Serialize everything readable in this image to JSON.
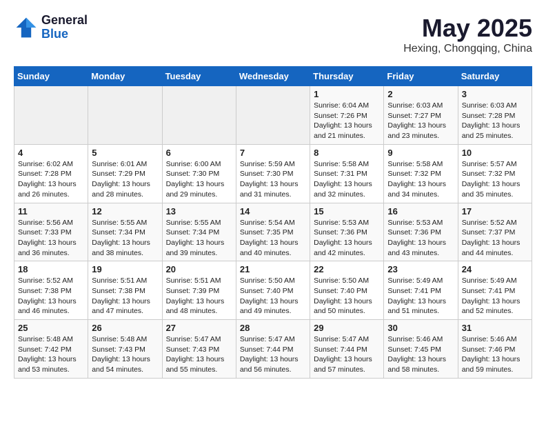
{
  "logo": {
    "general": "General",
    "blue": "Blue"
  },
  "title": "May 2025",
  "location": "Hexing, Chongqing, China",
  "days_of_week": [
    "Sunday",
    "Monday",
    "Tuesday",
    "Wednesday",
    "Thursday",
    "Friday",
    "Saturday"
  ],
  "weeks": [
    [
      {
        "day": "",
        "empty": true
      },
      {
        "day": "",
        "empty": true
      },
      {
        "day": "",
        "empty": true
      },
      {
        "day": "",
        "empty": true
      },
      {
        "day": "1",
        "sunrise": "6:04 AM",
        "sunset": "7:26 PM",
        "daylight": "13 hours and 21 minutes."
      },
      {
        "day": "2",
        "sunrise": "6:03 AM",
        "sunset": "7:27 PM",
        "daylight": "13 hours and 23 minutes."
      },
      {
        "day": "3",
        "sunrise": "6:03 AM",
        "sunset": "7:28 PM",
        "daylight": "13 hours and 25 minutes."
      }
    ],
    [
      {
        "day": "4",
        "sunrise": "6:02 AM",
        "sunset": "7:28 PM",
        "daylight": "13 hours and 26 minutes."
      },
      {
        "day": "5",
        "sunrise": "6:01 AM",
        "sunset": "7:29 PM",
        "daylight": "13 hours and 28 minutes."
      },
      {
        "day": "6",
        "sunrise": "6:00 AM",
        "sunset": "7:30 PM",
        "daylight": "13 hours and 29 minutes."
      },
      {
        "day": "7",
        "sunrise": "5:59 AM",
        "sunset": "7:30 PM",
        "daylight": "13 hours and 31 minutes."
      },
      {
        "day": "8",
        "sunrise": "5:58 AM",
        "sunset": "7:31 PM",
        "daylight": "13 hours and 32 minutes."
      },
      {
        "day": "9",
        "sunrise": "5:58 AM",
        "sunset": "7:32 PM",
        "daylight": "13 hours and 34 minutes."
      },
      {
        "day": "10",
        "sunrise": "5:57 AM",
        "sunset": "7:32 PM",
        "daylight": "13 hours and 35 minutes."
      }
    ],
    [
      {
        "day": "11",
        "sunrise": "5:56 AM",
        "sunset": "7:33 PM",
        "daylight": "13 hours and 36 minutes."
      },
      {
        "day": "12",
        "sunrise": "5:55 AM",
        "sunset": "7:34 PM",
        "daylight": "13 hours and 38 minutes."
      },
      {
        "day": "13",
        "sunrise": "5:55 AM",
        "sunset": "7:34 PM",
        "daylight": "13 hours and 39 minutes."
      },
      {
        "day": "14",
        "sunrise": "5:54 AM",
        "sunset": "7:35 PM",
        "daylight": "13 hours and 40 minutes."
      },
      {
        "day": "15",
        "sunrise": "5:53 AM",
        "sunset": "7:36 PM",
        "daylight": "13 hours and 42 minutes."
      },
      {
        "day": "16",
        "sunrise": "5:53 AM",
        "sunset": "7:36 PM",
        "daylight": "13 hours and 43 minutes."
      },
      {
        "day": "17",
        "sunrise": "5:52 AM",
        "sunset": "7:37 PM",
        "daylight": "13 hours and 44 minutes."
      }
    ],
    [
      {
        "day": "18",
        "sunrise": "5:52 AM",
        "sunset": "7:38 PM",
        "daylight": "13 hours and 46 minutes."
      },
      {
        "day": "19",
        "sunrise": "5:51 AM",
        "sunset": "7:38 PM",
        "daylight": "13 hours and 47 minutes."
      },
      {
        "day": "20",
        "sunrise": "5:51 AM",
        "sunset": "7:39 PM",
        "daylight": "13 hours and 48 minutes."
      },
      {
        "day": "21",
        "sunrise": "5:50 AM",
        "sunset": "7:40 PM",
        "daylight": "13 hours and 49 minutes."
      },
      {
        "day": "22",
        "sunrise": "5:50 AM",
        "sunset": "7:40 PM",
        "daylight": "13 hours and 50 minutes."
      },
      {
        "day": "23",
        "sunrise": "5:49 AM",
        "sunset": "7:41 PM",
        "daylight": "13 hours and 51 minutes."
      },
      {
        "day": "24",
        "sunrise": "5:49 AM",
        "sunset": "7:41 PM",
        "daylight": "13 hours and 52 minutes."
      }
    ],
    [
      {
        "day": "25",
        "sunrise": "5:48 AM",
        "sunset": "7:42 PM",
        "daylight": "13 hours and 53 minutes."
      },
      {
        "day": "26",
        "sunrise": "5:48 AM",
        "sunset": "7:43 PM",
        "daylight": "13 hours and 54 minutes."
      },
      {
        "day": "27",
        "sunrise": "5:47 AM",
        "sunset": "7:43 PM",
        "daylight": "13 hours and 55 minutes."
      },
      {
        "day": "28",
        "sunrise": "5:47 AM",
        "sunset": "7:44 PM",
        "daylight": "13 hours and 56 minutes."
      },
      {
        "day": "29",
        "sunrise": "5:47 AM",
        "sunset": "7:44 PM",
        "daylight": "13 hours and 57 minutes."
      },
      {
        "day": "30",
        "sunrise": "5:46 AM",
        "sunset": "7:45 PM",
        "daylight": "13 hours and 58 minutes."
      },
      {
        "day": "31",
        "sunrise": "5:46 AM",
        "sunset": "7:46 PM",
        "daylight": "13 hours and 59 minutes."
      }
    ]
  ],
  "labels": {
    "sunrise": "Sunrise:",
    "sunset": "Sunset:",
    "daylight": "Daylight:"
  }
}
